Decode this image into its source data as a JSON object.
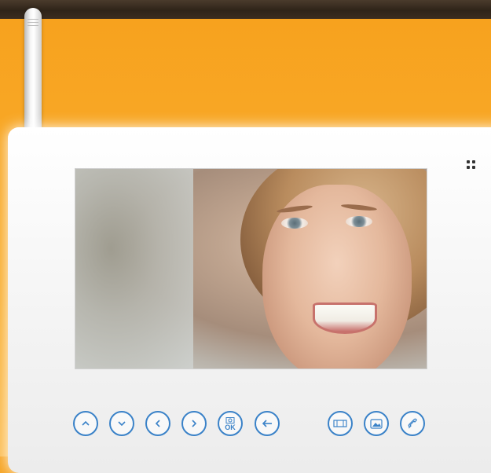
{
  "device": {
    "type": "video-intercom-monitor",
    "screen_content": "video-feed-portrait",
    "colors": {
      "background": "#f6a423",
      "top_bar": "#2f2419",
      "button_accent": "#3a82c8",
      "body": "#f4f4f4"
    }
  },
  "controls": {
    "up": {
      "icon": "chevron-up-icon"
    },
    "down": {
      "icon": "chevron-down-icon"
    },
    "left": {
      "icon": "chevron-left-icon"
    },
    "right": {
      "icon": "chevron-right-icon"
    },
    "ok": {
      "icon": "camera-icon",
      "label": "OK"
    },
    "back": {
      "icon": "back-arrow-icon"
    },
    "door": {
      "icon": "gate-icon"
    },
    "gallery": {
      "icon": "photo-icon"
    },
    "call": {
      "icon": "handset-icon"
    }
  }
}
